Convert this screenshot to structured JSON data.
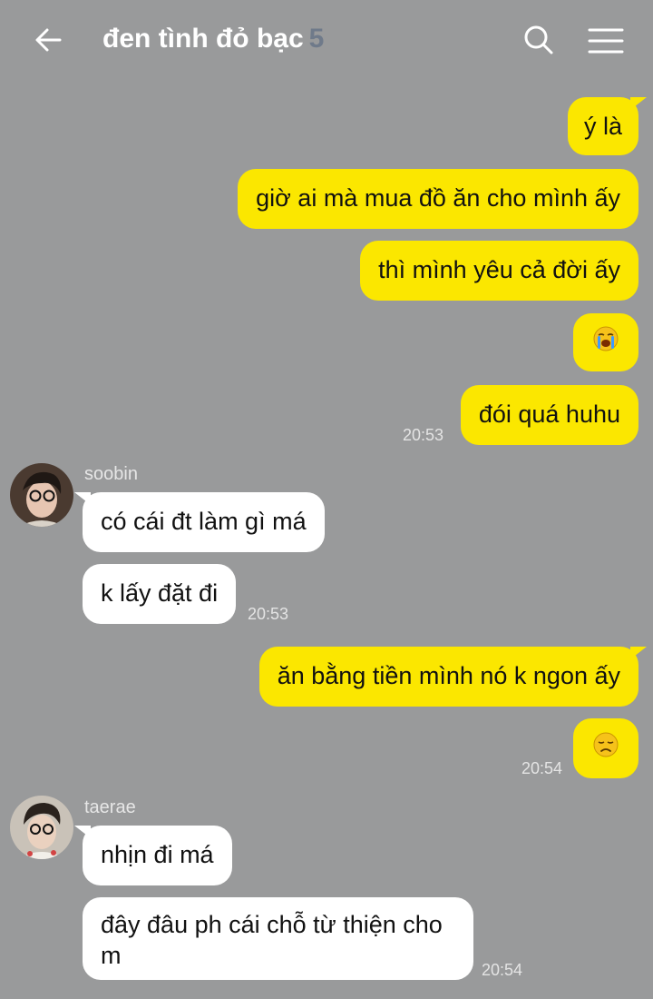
{
  "header": {
    "title": "đen tình đỏ bạc",
    "member_count": "5"
  },
  "messages": {
    "m1": "ý là",
    "m2": "giờ ai mà mua đồ ăn cho mình ấy",
    "m3": "thì mình yêu cả đời ấy",
    "m4_emoji": "crying-face-emoji",
    "m5": "đói quá huhu",
    "t1": "20:53",
    "soobin_name": "soobin",
    "s1": "có cái đt làm gì má",
    "s2": "k lấy đặt đi",
    "t2": "20:53",
    "m6": "ăn bằng tiền mình nó k ngon ấy",
    "m7_emoji": "disappointed-face-emoji",
    "t3": "20:54",
    "taerae_name": "taerae",
    "r1": "nhịn đi má",
    "r2_line1": "đây đâu ph cái chỗ từ thiện cho",
    "r2_line2": "m",
    "t4": "20:54"
  },
  "colors": {
    "background": "#999a9b",
    "my_bubble": "#fbe700",
    "their_bubble": "#ffffff",
    "member_count": "#6f7a8a"
  }
}
